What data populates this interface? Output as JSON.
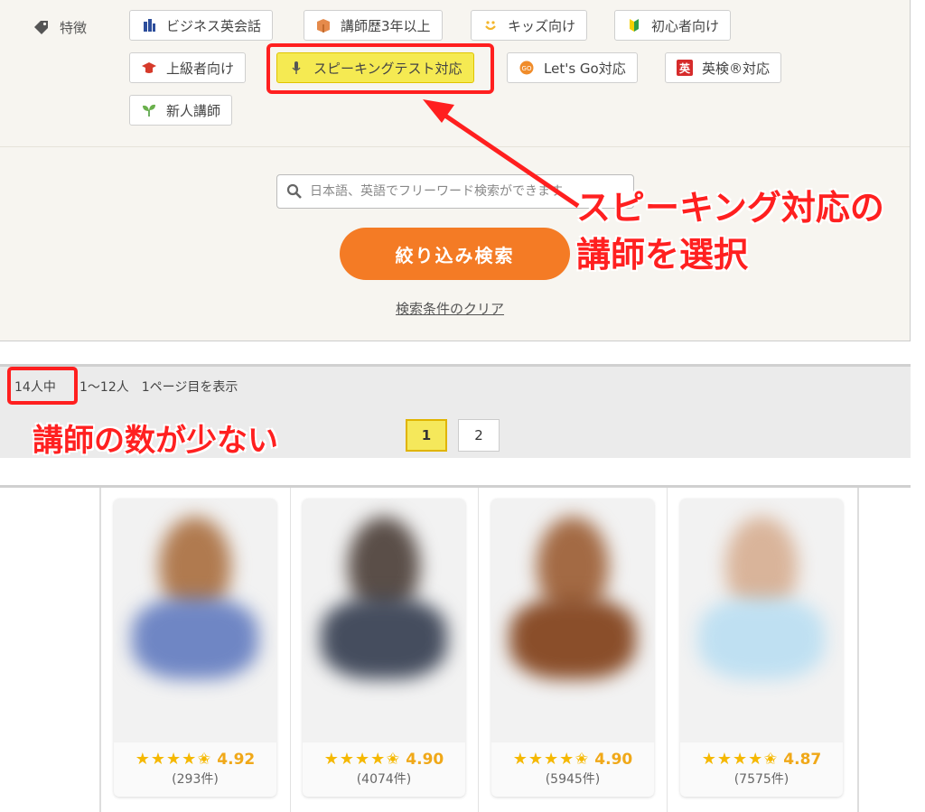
{
  "filter": {
    "label": "特徴",
    "chips": [
      {
        "label": "ビジネス英会話",
        "icon": "building-icon"
      },
      {
        "label": "講師歴3年以上",
        "icon": "box-icon"
      },
      {
        "label": "キッズ向け",
        "icon": "smile-icon"
      },
      {
        "label": "初心者向け",
        "icon": "beginner-mark-icon"
      },
      {
        "label": "上級者向け",
        "icon": "graduation-cap-icon"
      },
      {
        "label": "スピーキングテスト対応",
        "icon": "microphone-icon",
        "active": true
      },
      {
        "label": "Let's Go対応",
        "icon": "letsgo-icon"
      },
      {
        "label": "英検®対応",
        "icon": "eiken-icon",
        "badge": "英"
      },
      {
        "label": "新人講師",
        "icon": "sprout-icon"
      }
    ],
    "search_placeholder": "日本語、英語でフリーワード検索ができます",
    "search_button": "絞り込み検索",
    "clear_link": "検索条件のクリア"
  },
  "annotations": {
    "main_line1": "スピーキング対応の",
    "main_line2": "講師を選択",
    "count_note": "講師の数が少ない"
  },
  "results": {
    "count": "14人中",
    "range": "1〜12人　1ページ目を表示",
    "pages": [
      "1",
      "2"
    ],
    "current_page": "1"
  },
  "teachers": [
    {
      "rating": "4.92",
      "reviews": "(293件)"
    },
    {
      "rating": "4.90",
      "reviews": "(4074件)"
    },
    {
      "rating": "4.90",
      "reviews": "(5945件)"
    },
    {
      "rating": "4.87",
      "reviews": "(7575件)"
    }
  ],
  "colors": {
    "accent_orange": "#f47b25",
    "active_chip": "#f5ea52",
    "annotation_red": "#ff2020",
    "star": "#f5b800"
  }
}
